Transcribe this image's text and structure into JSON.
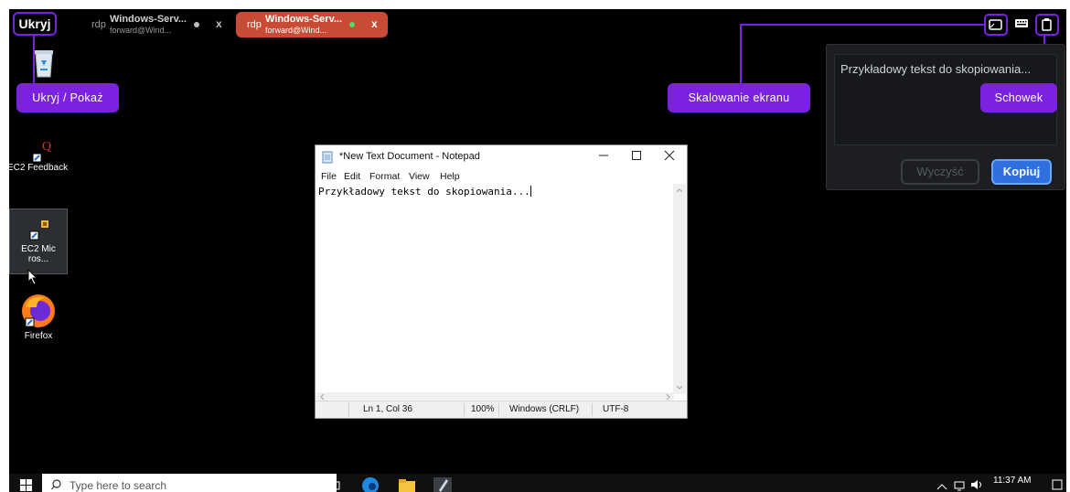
{
  "topbar": {
    "hide_label": "Ukryj",
    "tabs": [
      {
        "proto": "rdp",
        "title": "Windows-Serv...",
        "subtitle": "forward@Wind...",
        "close": "x"
      },
      {
        "proto": "rdp",
        "title": "Windows-Serv...",
        "subtitle": "forward@Wind...",
        "close": "x"
      }
    ]
  },
  "tooltips": {
    "hide_show": "Ukryj / Pokaż",
    "scaling": "Skalowanie ekranu",
    "clipboard": "Schowek"
  },
  "clipboard": {
    "text": "Przykładowy tekst do skopiowania...",
    "clear_label": "Wyczyść",
    "copy_label": "Kopiuj"
  },
  "desktop": {
    "icons": [
      {
        "label": "EC2 Feedback"
      },
      {
        "label": "EC2 Micros..."
      },
      {
        "label": "Firefox"
      }
    ]
  },
  "notepad": {
    "title": "*New Text Document - Notepad",
    "menu": [
      "File",
      "Edit",
      "Format",
      "View",
      "Help"
    ],
    "content": "Przykładowy tekst do skopiowania...",
    "status": {
      "position": "Ln 1, Col 36",
      "zoom": "100%",
      "line_endings": "Windows (CRLF)",
      "encoding": "UTF-8"
    }
  },
  "taskbar": {
    "search_placeholder": "Type here to search",
    "time": "11:37 AM"
  },
  "colors": {
    "accent": "#7a22e0",
    "active_tab": "#c74b35",
    "copy_button": "#2f6fde"
  }
}
